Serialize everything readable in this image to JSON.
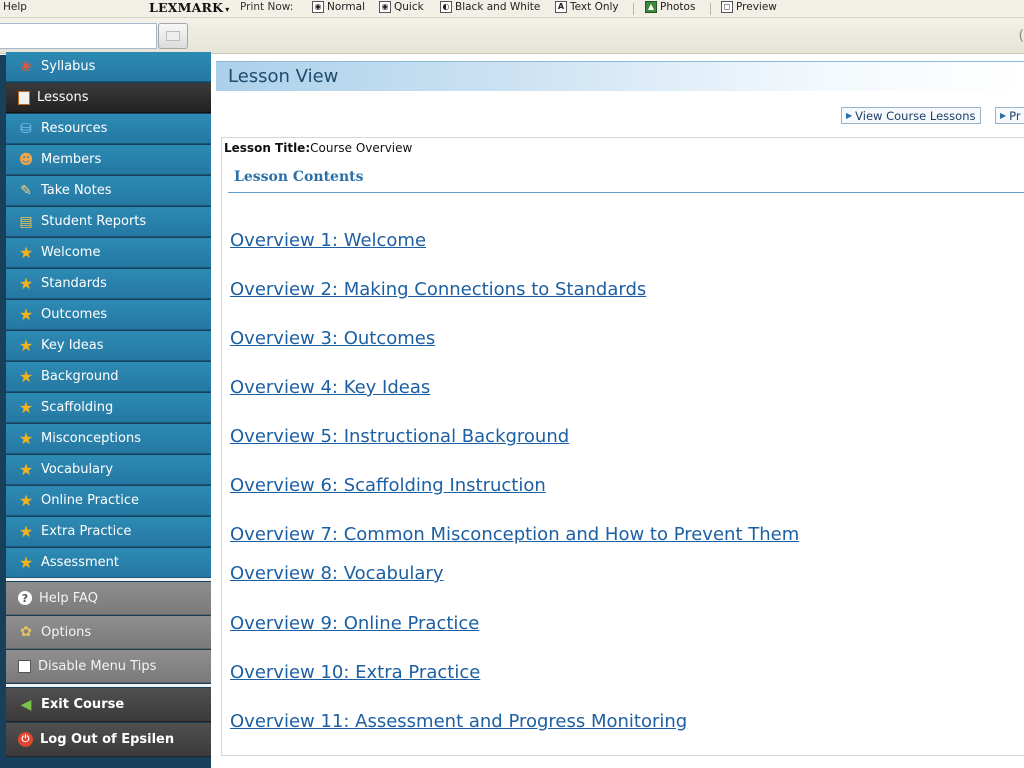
{
  "toolbar": {
    "help_label": "Help",
    "brand": "LEXMARK",
    "brand_caret": "▾",
    "print_now_label": "Print Now:",
    "buttons": [
      {
        "label": "Normal",
        "icon": "printer-icon"
      },
      {
        "label": "Quick",
        "icon": "printer-icon"
      },
      {
        "label": "Black and White",
        "icon": "bw-printer-icon"
      },
      {
        "label": "Text Only",
        "icon": "text-a-icon"
      },
      {
        "label": "Photos",
        "icon": "photo-icon"
      },
      {
        "label": "Preview",
        "icon": "preview-icon"
      }
    ]
  },
  "sidebar": {
    "items": [
      {
        "label": "Syllabus",
        "icon": "syllabus-book-icon"
      },
      {
        "label": "Lessons",
        "icon": "lessons-doc-icon",
        "active": true
      },
      {
        "label": "Resources",
        "icon": "resources-icon"
      },
      {
        "label": "Members",
        "icon": "members-icon"
      },
      {
        "label": "Take Notes",
        "icon": "notes-icon"
      },
      {
        "label": "Student Reports",
        "icon": "reports-icon"
      },
      {
        "label": "Welcome",
        "icon": "star-icon"
      },
      {
        "label": "Standards",
        "icon": "star-icon"
      },
      {
        "label": "Outcomes",
        "icon": "star-icon"
      },
      {
        "label": "Key Ideas",
        "icon": "star-icon"
      },
      {
        "label": "Background",
        "icon": "star-icon"
      },
      {
        "label": "Scaffolding",
        "icon": "star-icon"
      },
      {
        "label": "Misconceptions",
        "icon": "star-icon"
      },
      {
        "label": "Vocabulary",
        "icon": "star-icon"
      },
      {
        "label": "Online Practice",
        "icon": "star-icon"
      },
      {
        "label": "Extra Practice",
        "icon": "star-icon"
      },
      {
        "label": "Assessment",
        "icon": "star-icon"
      }
    ],
    "help_faq": "Help FAQ",
    "options": "Options",
    "disable_menu_tips": "Disable Menu Tips",
    "exit_course": "Exit Course",
    "log_out": "Log Out of Epsilen"
  },
  "main": {
    "header_title": "Lesson View",
    "view_course_lessons": "View Course Lessons",
    "next_button_partial": "Pr",
    "lesson_title_label": "Lesson Title:",
    "lesson_title_value": "Course Overview",
    "contents_heading": "Lesson Contents",
    "links": [
      "Overview 1: Welcome",
      "Overview 2: Making Connections to Standards",
      "Overview 3: Outcomes",
      "Overview 4: Key Ideas",
      "Overview 5: Instructional Background",
      "Overview 6: Scaffolding Instruction",
      "Overview 7: Common Misconception and How to Prevent Them",
      "Overview 8: Vocabulary",
      "Overview 9: Online Practice",
      "Overview 10: Extra Practice",
      "Overview 11: Assessment and Progress Monitoring"
    ]
  },
  "colors": {
    "nav_blue": "#2d8bb3",
    "nav_dark": "#2a2a2a",
    "link_blue": "#1c5fa3",
    "star": "#f4b21c"
  }
}
